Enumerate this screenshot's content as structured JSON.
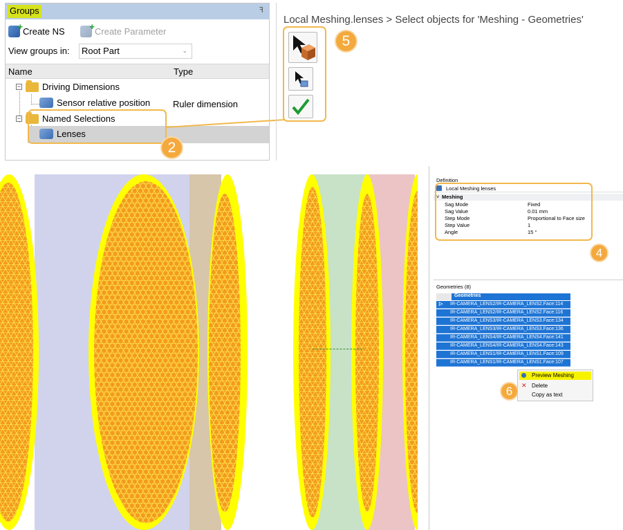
{
  "groups_panel": {
    "title": "Groups",
    "pin_glyph": "ꟻ",
    "create_ns": "Create NS",
    "create_parameter": "Create Parameter",
    "view_groups_label": "View groups in:",
    "view_groups_value": "Root Part",
    "columns": {
      "name": "Name",
      "type": "Type"
    },
    "tree": {
      "driving_dimensions": "Driving Dimensions",
      "sensor_position": "Sensor relative position",
      "sensor_type": "Ruler dimension",
      "named_selections": "Named Selections",
      "lenses": "Lenses"
    },
    "expander_glyph": "−"
  },
  "breadcrumb": "Local Meshing.lenses > Select objects for 'Meshing - Geometries'",
  "callouts": {
    "two": "2",
    "four": "4",
    "five": "5",
    "six": "6"
  },
  "definition_panel": {
    "header": "Definition",
    "object_name": "Local Meshing lenses",
    "section": "Meshing",
    "properties": [
      {
        "key": "Sag Mode",
        "value": "Fixed"
      },
      {
        "key": "Sag Value",
        "value": "0.01 mm"
      },
      {
        "key": "Step Mode",
        "value": "Proportional to Face size"
      },
      {
        "key": "Step Value",
        "value": "1"
      },
      {
        "key": "Angle",
        "value": "15 °"
      }
    ],
    "geometries_label": "Geometries (8)",
    "geometries_header": "Geometries",
    "geometries": [
      "IR-CAMERA_LENS2/IR-CAMERA_LENS2.Face:114",
      "IR-CAMERA_LENS2/IR-CAMERA_LENS2.Face:116",
      "IR-CAMERA_LENS3/IR-CAMERA_LENS3.Face:134",
      "IR-CAMERA_LENS3/IR-CAMERA_LENS3.Face:136",
      "IR-CAMERA_LENS4/IR-CAMERA_LENS4.Face:141",
      "IR-CAMERA_LENS4/IR-CAMERA_LENS4.Face:143",
      "IR-CAMERA_LENS1/IR-CAMERA_LENS1.Face:109",
      "IR-CAMERA_LENS1/IR-CAMERA_LENS1.Face:107"
    ],
    "context_menu": {
      "preview": "Preview Meshing",
      "delete": "Delete",
      "copy": "Copy as text"
    }
  },
  "colors": {
    "highlight": "#d6e21c",
    "callout": "#f4a93d",
    "selection": "#1e74d4",
    "mesh": "#f39b1e"
  }
}
